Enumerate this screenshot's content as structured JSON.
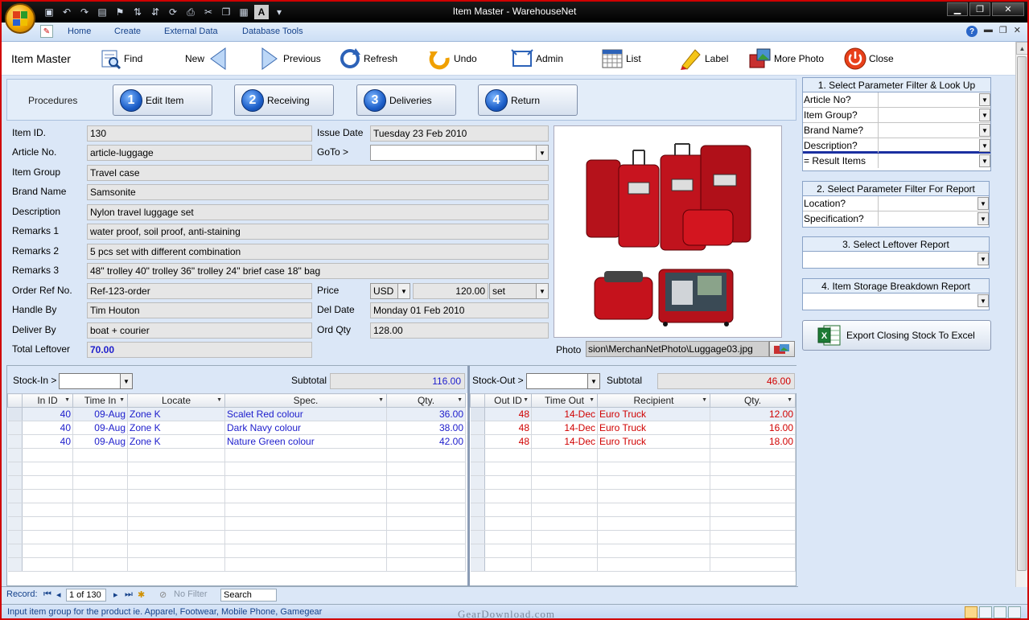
{
  "window": {
    "title": "Item Master - WarehouseNet",
    "controls": [
      "minimize",
      "restore",
      "close"
    ]
  },
  "ribbon": {
    "tabs": [
      "Home",
      "Create",
      "External Data",
      "Database Tools"
    ]
  },
  "toolbar": {
    "title": "Item Master",
    "buttons": [
      {
        "label": "Find",
        "icon": "find-icon"
      },
      {
        "label": "New",
        "icon": "left-arrow-icon"
      },
      {
        "label": "Previous",
        "icon": "right-arrow-icon"
      },
      {
        "label": "Refresh",
        "icon": "refresh-icon"
      },
      {
        "label": "Undo",
        "icon": "undo-icon"
      },
      {
        "label": "Admin",
        "icon": "admin-icon"
      },
      {
        "label": "List",
        "icon": "list-icon"
      },
      {
        "label": "Label",
        "icon": "label-icon"
      },
      {
        "label": "More Photo",
        "icon": "photo-icon"
      },
      {
        "label": "Close",
        "icon": "close-icon"
      }
    ]
  },
  "procedures": {
    "label": "Procedures",
    "buttons": [
      {
        "num": "1",
        "label": "Edit Item"
      },
      {
        "num": "2",
        "label": "Receiving"
      },
      {
        "num": "3",
        "label": "Deliveries"
      },
      {
        "num": "4",
        "label": "Return"
      }
    ]
  },
  "form": {
    "item_id": {
      "label": "Item ID.",
      "value": "130"
    },
    "article_no": {
      "label": "Article No.",
      "value": "article-luggage"
    },
    "item_group": {
      "label": "Item Group",
      "value": "Travel case"
    },
    "brand_name": {
      "label": "Brand Name",
      "value": "Samsonite"
    },
    "description": {
      "label": "Description",
      "value": "Nylon travel luggage set"
    },
    "remarks1": {
      "label": "Remarks 1",
      "value": "water proof, soil proof, anti-staining"
    },
    "remarks2": {
      "label": "Remarks 2",
      "value": "5 pcs set with different combination"
    },
    "remarks3": {
      "label": "Remarks 3",
      "value": "48\" trolley 40\" trolley 36\" trolley 24\" brief case 18\" bag"
    },
    "order_ref": {
      "label": "Order Ref No.",
      "value": "Ref-123-order"
    },
    "handle_by": {
      "label": "Handle By",
      "value": "Tim Houton"
    },
    "deliver_by": {
      "label": "Deliver By",
      "value": "boat + courier"
    },
    "total_leftover": {
      "label": "Total Leftover",
      "value": "70.00"
    },
    "issue_date": {
      "label": "Issue Date",
      "value": "Tuesday 23 Feb 2010"
    },
    "goto": {
      "label": "GoTo >",
      "value": ""
    },
    "price": {
      "label": "Price",
      "currency": "USD",
      "amount": "120.00",
      "unit": "set"
    },
    "del_date": {
      "label": "Del Date",
      "value": "Monday 01 Feb 2010"
    },
    "ord_qty": {
      "label": "Ord Qty",
      "value": "128.00"
    },
    "photo": {
      "label": "Photo",
      "path": "sion\\MerchanNetPhoto\\Luggage03.jpg"
    }
  },
  "right_panel": {
    "lookup": {
      "title": "1. Select Parameter Filter & Look Up",
      "rows": [
        "Article No?",
        "Item Group?",
        "Brand Name?",
        "Description?"
      ],
      "result": "= Result Items"
    },
    "report_filter": {
      "title": "2. Select Parameter Filter For Report",
      "rows": [
        "Location?",
        "Specification?"
      ]
    },
    "leftover": {
      "title": "3. Select Leftover Report"
    },
    "storage": {
      "title": "4. Item Storage Breakdown Report"
    },
    "export_label": "Export Closing Stock To Excel"
  },
  "stock_in": {
    "label": "Stock-In >",
    "subtotal_label": "Subtotal",
    "subtotal": "116.00",
    "columns": [
      "In ID",
      "Time In",
      "Locate",
      "Spec.",
      "Qty."
    ],
    "rows": [
      [
        "40",
        "09-Aug",
        "Zone K",
        "Scalet Red colour",
        "36.00"
      ],
      [
        "40",
        "09-Aug",
        "Zone K",
        "Dark Navy colour",
        "38.00"
      ],
      [
        "40",
        "09-Aug",
        "Zone K",
        "Nature Green colour",
        "42.00"
      ]
    ]
  },
  "stock_out": {
    "label": "Stock-Out >",
    "subtotal_label": "Subtotal",
    "subtotal": "46.00",
    "columns": [
      "Out ID",
      "Time Out",
      "Recipient",
      "Qty."
    ],
    "rows": [
      [
        "48",
        "14-Dec",
        "Euro Truck",
        "12.00"
      ],
      [
        "48",
        "14-Dec",
        "Euro Truck",
        "16.00"
      ],
      [
        "48",
        "14-Dec",
        "Euro Truck",
        "18.00"
      ]
    ]
  },
  "record_nav": {
    "label": "Record:",
    "position": "1 of 130",
    "filter": "No Filter",
    "search": "Search"
  },
  "status": {
    "text": "Input item group for the product  ie. Apparel, Footwear, Mobile Phone, Gamegear",
    "watermark": "GearDownload.com"
  },
  "colors": {
    "accent": "#15428b",
    "window_border": "#d00000",
    "stock_in_text": "#1d1dcc",
    "stock_out_text": "#d00000"
  }
}
